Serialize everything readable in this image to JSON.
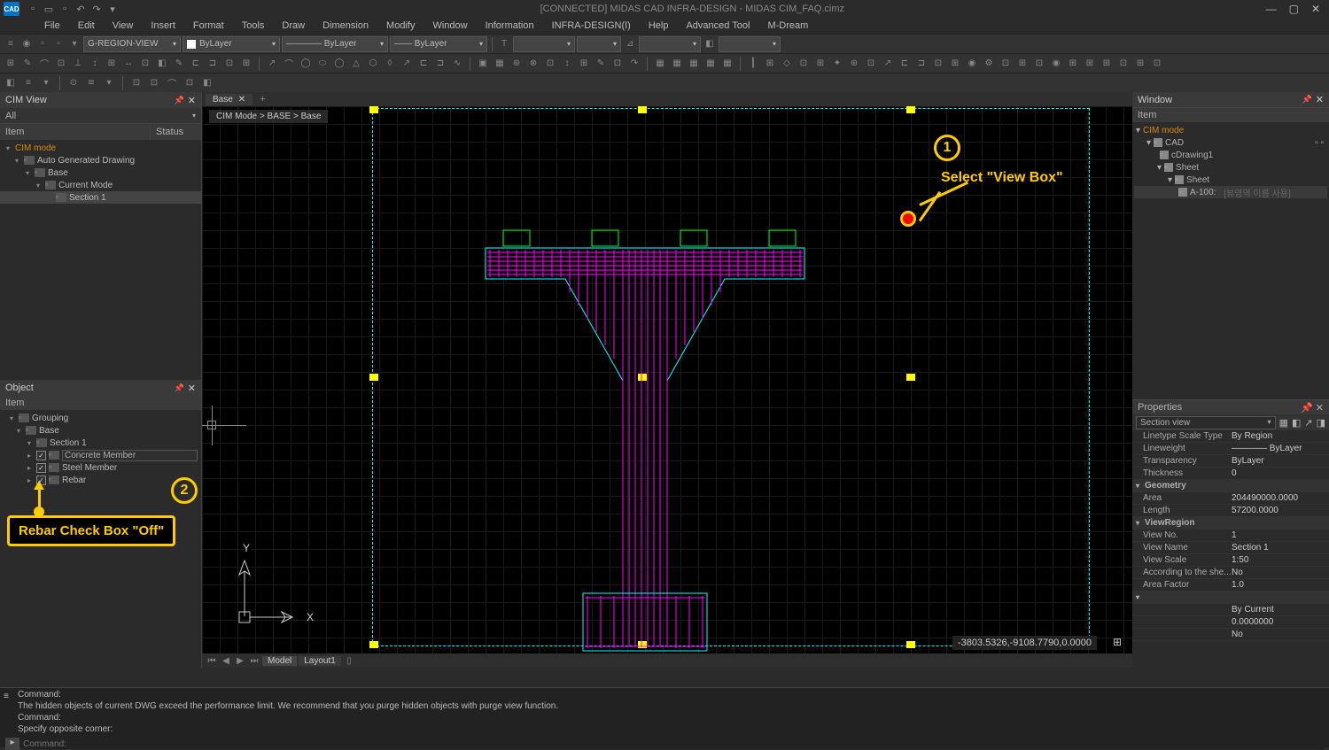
{
  "titlebar": {
    "logo": "CAD",
    "title": "[CONNECTED] MIDAS CAD INFRA-DESIGN - MIDAS CIM_FAQ.cimz"
  },
  "menu": [
    "File",
    "Edit",
    "View",
    "Insert",
    "Format",
    "Tools",
    "Draw",
    "Dimension",
    "Modify",
    "Window",
    "Information",
    "INFRA-DESIGN(I)",
    "Help",
    "Advanced Tool",
    "M-Dream"
  ],
  "toolbar1": {
    "layer": "G-REGION-VIEW",
    "bylayer1": "ByLayer",
    "bylayer2": "ByLayer",
    "bylayer3": "ByLayer"
  },
  "panels": {
    "cimview_title": "CIM View",
    "filter": "All",
    "col_item": "Item",
    "col_status": "Status",
    "object_title": "Object",
    "window_title": "Window",
    "props_title": "Properties"
  },
  "cimtree": {
    "root": "CIM mode",
    "n1": "Auto Generated Drawing",
    "n2": "Base",
    "n3": "Current Mode",
    "n4": "Section 1"
  },
  "objtree": {
    "hdr": "Item",
    "grouping": "Grouping",
    "base": "Base",
    "section": "Section 1",
    "concrete": "Concrete Member",
    "steel": "Steel Member",
    "rebar": "Rebar"
  },
  "canvas": {
    "tab": "Base",
    "breadcrumb": "CIM Mode > BASE > Base",
    "coords": "-3803.5326,-9108.7790,0.0000",
    "model": "Model",
    "layout": "Layout1"
  },
  "wintree": {
    "hdr": "Item",
    "root": "CIM mode",
    "cad": "CAD",
    "cdraw": "cDrawing1",
    "sheet": "Sheet",
    "sheet2": "Sheet",
    "a100": "A-100:",
    "a100v": "[뷰영역 이름 사용]"
  },
  "props": {
    "type": "Section view",
    "rows": [
      {
        "k": "Linetype Scale Type",
        "v": "By Region"
      },
      {
        "k": "Lineweight",
        "v": "———— ByLayer"
      },
      {
        "k": "Transparency",
        "v": "ByLayer"
      },
      {
        "k": "Thickness",
        "v": "0"
      }
    ],
    "geom": "Geometry",
    "grows": [
      {
        "k": "Area",
        "v": "204490000.0000"
      },
      {
        "k": "Length",
        "v": "57200.0000"
      }
    ],
    "vreg": "ViewRegion",
    "vrows": [
      {
        "k": "View No.",
        "v": "1"
      },
      {
        "k": "View Name",
        "v": "Section 1"
      },
      {
        "k": "View Scale",
        "v": "1:50"
      },
      {
        "k": "According to the she...",
        "v": "No"
      },
      {
        "k": "Area Factor",
        "v": "1.0"
      },
      {
        "k": "",
        "v": ""
      },
      {
        "k": "",
        "v": "By Current"
      },
      {
        "k": "",
        "v": "0.0000000"
      },
      {
        "k": "",
        "v": "No"
      }
    ]
  },
  "cmd": {
    "l1": "Command:",
    "l2": "The hidden objects of current DWG exceed the performance limit. We recommend that you purge hidden objects with purge view function.",
    "l3": "Command:",
    "l4": "Specify opposite corner:",
    "prompt": "Command:"
  },
  "annot": {
    "n1": "1",
    "t1": "Select \"View Box\"",
    "n2": "2",
    "t2": "Rebar Check Box \"Off\""
  }
}
